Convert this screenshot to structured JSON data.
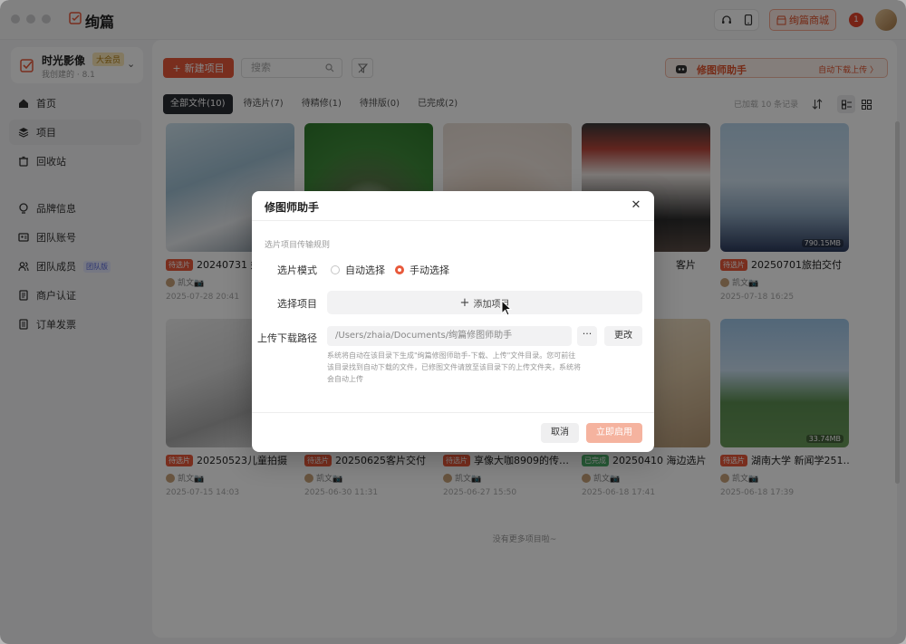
{
  "app": {
    "name": "绚篇",
    "mall_label": "绚篇商城",
    "notification_count": "1"
  },
  "org": {
    "name": "时光影像",
    "tag": "大会员",
    "sub": "我创建的 · 8.1"
  },
  "nav": [
    {
      "label": "首页"
    },
    {
      "label": "项目"
    },
    {
      "label": "回收站"
    },
    {
      "label": "品牌信息"
    },
    {
      "label": "团队账号"
    },
    {
      "label": "团队成员",
      "tag": "团队版"
    },
    {
      "label": "商户认证"
    },
    {
      "label": "订单发票"
    }
  ],
  "toolbar": {
    "new_project": "新建项目",
    "search_placeholder": "搜索",
    "helper_title": "修图师助手",
    "helper_status": "自动下载上传 〉"
  },
  "tabs": [
    {
      "label": "全部文件(10)"
    },
    {
      "label": "待选片(7)"
    },
    {
      "label": "待精修(1)"
    },
    {
      "label": "待排版(0)"
    },
    {
      "label": "已完成(2)"
    }
  ],
  "loaded_text": "已加载 10 条记录",
  "cards": [
    {
      "title": "20240731 婚…",
      "status": "待选片",
      "owner": "凯文📷",
      "date": "2025-07-28 20:41",
      "size": ""
    },
    {
      "title": "",
      "status": "",
      "owner": "",
      "date": "",
      "size": ""
    },
    {
      "title": "",
      "status": "",
      "owner": "",
      "date": "",
      "size": ""
    },
    {
      "title": "客片",
      "status": "",
      "owner": "",
      "date": "",
      "size": ""
    },
    {
      "title": "20250701旅拍交付",
      "status": "待选片",
      "owner": "凯文📷",
      "date": "2025-07-18 16:25",
      "size": "790.15MB"
    },
    {
      "title": "20250523儿童拍摄",
      "status": "待选片",
      "owner": "凯文📷",
      "date": "2025-07-15 14:03",
      "size": ""
    },
    {
      "title": "20250625客片交付",
      "status": "待选片",
      "owner": "凯文📷",
      "date": "2025-06-30 11:31",
      "size": ""
    },
    {
      "title": "享像大咖8909的传…",
      "status": "待选片",
      "owner": "凯文📷",
      "date": "2025-06-27 15:50",
      "size": ""
    },
    {
      "title": "20250410 海边选片",
      "status": "已完成",
      "owner": "凯文📷",
      "date": "2025-06-18 17:41",
      "size": ""
    },
    {
      "title": "湖南大学 新闻学251…",
      "status": "待选片",
      "owner": "凯文📷",
      "date": "2025-06-18 17:39",
      "size": "33.74MB"
    }
  ],
  "no_more": "没有更多项目啦~",
  "modal": {
    "title": "修图师助手",
    "section": "选片项目传输规则",
    "mode_label": "选片模式",
    "mode_auto": "自动选择",
    "mode_manual": "手动选择",
    "select_label": "选择项目",
    "add_item": "添加项目",
    "path_label": "上传下载路径",
    "path_value": "/Users/zhaia/Documents/绚篇修图师助手",
    "dots": "···",
    "change": "更改",
    "help": "系统将自动在该目录下生成\"绚篇修图师助手-下载、上传\"文件目录。您可前往该目录找到自动下载的文件，已修图文件请放至该目录下的上传文件夹，系统将会自动上传",
    "cancel": "取消",
    "start": "立即启用"
  },
  "colors": {
    "accent": "#e8593b",
    "done": "#4caf6a"
  }
}
